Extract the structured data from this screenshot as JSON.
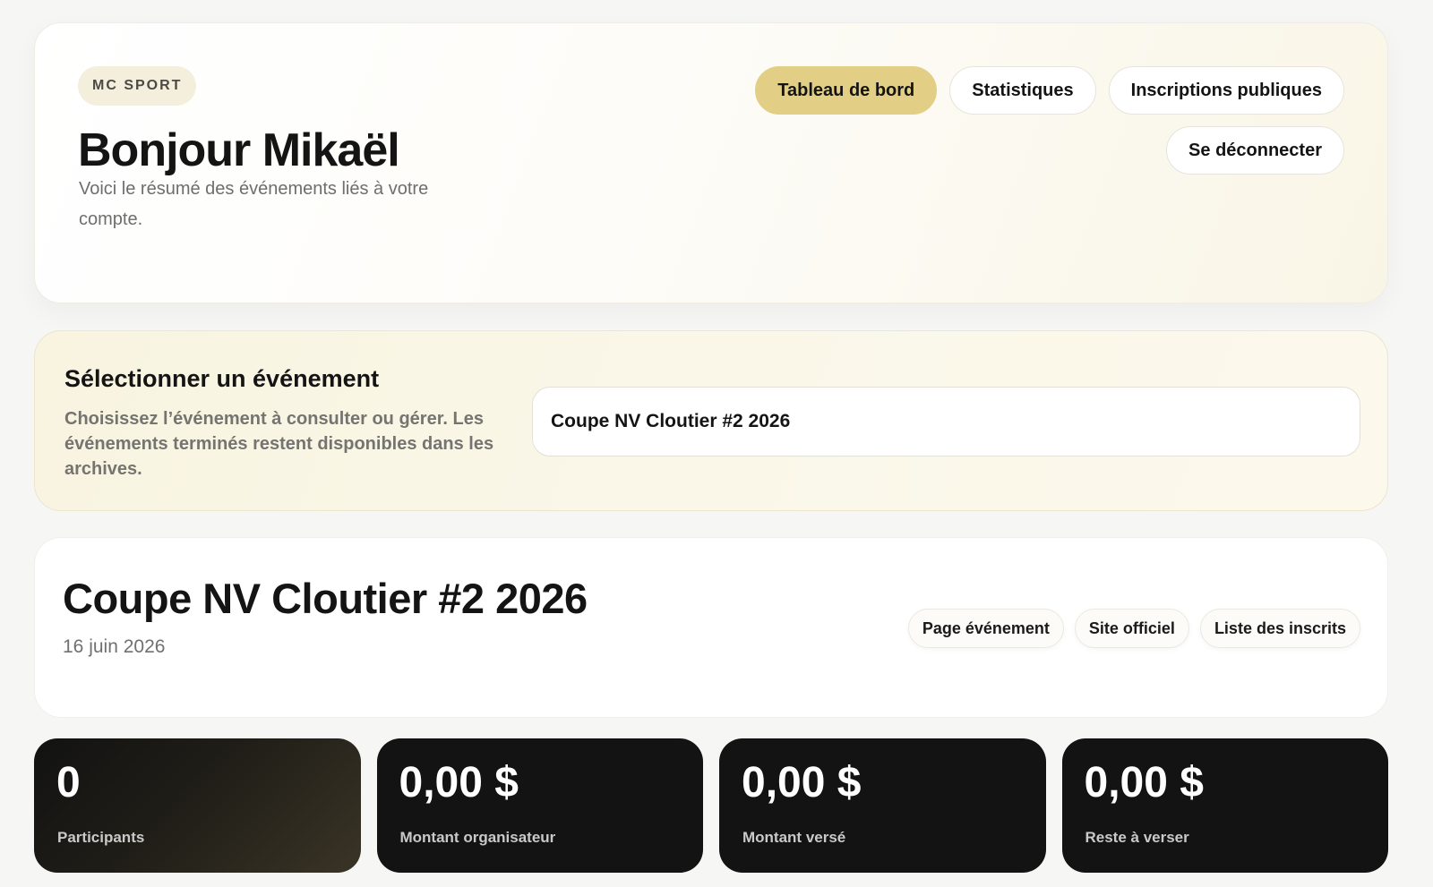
{
  "header": {
    "brand": "MC SPORT",
    "greeting": "Bonjour Mikaël",
    "subtitle": "Voici le résumé des événements liés à votre compte.",
    "nav": [
      {
        "label": "Tableau de bord",
        "active": true
      },
      {
        "label": "Statistiques",
        "active": false
      },
      {
        "label": "Inscriptions publiques",
        "active": false
      }
    ],
    "logout_label": "Se déconnecter"
  },
  "selector": {
    "title": "Sélectionner un événement",
    "description": "Choisissez l’événement à consulter ou gérer. Les événements terminés restent disponibles dans les archives.",
    "selected_event": "Coupe NV Cloutier #2 2026"
  },
  "event": {
    "title": "Coupe NV Cloutier #2 2026",
    "date": "16 juin 2026",
    "links": [
      "Page événement",
      "Site officiel",
      "Liste des inscrits"
    ]
  },
  "stats": [
    {
      "value": "0",
      "label": "Participants"
    },
    {
      "value": "0,00 $",
      "label": "Montant organisateur"
    },
    {
      "value": "0,00 $",
      "label": "Montant versé"
    },
    {
      "value": "0,00 $",
      "label": "Reste à verser"
    }
  ],
  "colors": {
    "accent": "#e2cf85",
    "stat_card_bg": "#131313",
    "selector_bg": "#f8f4e0"
  }
}
